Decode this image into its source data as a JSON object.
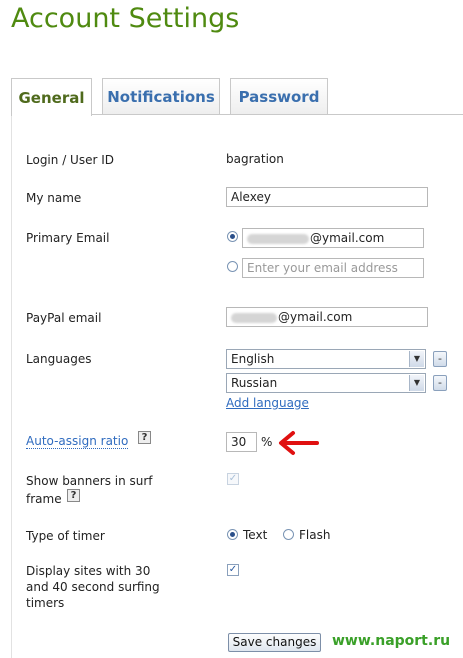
{
  "page": {
    "title": "Account Settings"
  },
  "tabs": [
    {
      "label": "General",
      "active": true
    },
    {
      "label": "Notifications",
      "active": false
    },
    {
      "label": "Password",
      "active": false
    }
  ],
  "form": {
    "login": {
      "label": "Login / User ID",
      "value": "bagration"
    },
    "name": {
      "label": "My name",
      "value": "Alexey"
    },
    "primary_email": {
      "label": "Primary Email",
      "selected_domain": "@ymail.com",
      "placeholder": "Enter your email address"
    },
    "paypal": {
      "label": "PayPal email",
      "domain": "@ymail.com"
    },
    "languages": {
      "label": "Languages",
      "selected": [
        "English",
        "Russian"
      ],
      "remove_label": "-",
      "add_label": "Add language"
    },
    "auto_assign": {
      "label": "Auto-assign ratio",
      "value": "30",
      "unit": "%",
      "help": "?"
    },
    "banners": {
      "label_line1": "Show banners in surf",
      "label_line2": "frame",
      "help": "?",
      "checked": true
    },
    "timer": {
      "label": "Type of timer",
      "options": [
        "Text",
        "Flash"
      ],
      "selected": "Text"
    },
    "display_sites": {
      "label_lines": [
        "Display sites with 30",
        "and 40 second surfing",
        "timers"
      ],
      "checked": true
    },
    "save_label": "Save changes"
  },
  "watermark": "www.naport.ru",
  "colors": {
    "title": "#4f8a10",
    "tab_text": "#3a6fae",
    "link": "#2f6bbf",
    "arrow": "#e01010",
    "watermark": "#3aa028"
  }
}
